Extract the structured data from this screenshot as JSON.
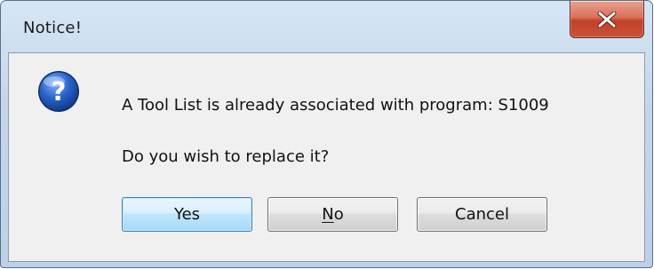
{
  "window": {
    "title": "Notice!"
  },
  "close_button": {
    "icon": "close-icon"
  },
  "message": {
    "icon": "question-icon",
    "line1": "A Tool List is already associated with program: S1009",
    "line2": "Do you wish to replace it?"
  },
  "buttons": {
    "yes_label": "Yes",
    "no_label_first": "N",
    "no_label_rest": "o",
    "cancel_label": "Cancel"
  },
  "colors": {
    "close_red": "#c2412a",
    "default_button_border": "#3c7fb1",
    "question_icon_blue": "#1f4fa6"
  }
}
